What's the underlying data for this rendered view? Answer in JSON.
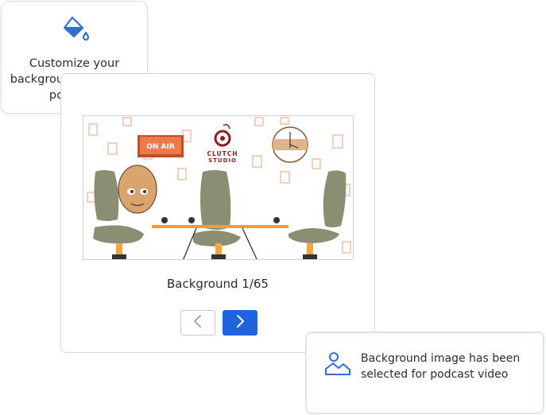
{
  "tooltip": {
    "icon": "paint-bucket-icon",
    "text": "Customize your background to fit your podcast!"
  },
  "preview": {
    "sign_text": "ON AIR",
    "logo_line1": "CLUTCH",
    "logo_line2": "STUDIO"
  },
  "background": {
    "label": "Background 1/65"
  },
  "navigation": {
    "prev_icon": "chevron-left-icon",
    "next_icon": "chevron-right-icon"
  },
  "notification": {
    "icon": "image-icon",
    "text": "Background image has been selected for podcast video"
  },
  "colors": {
    "accent": "#1f63e0",
    "icon_blue": "#2f6fd8",
    "sign_orange": "#e0652f",
    "table_orange": "#f29a3a",
    "chair_green": "#8a8f74",
    "logo_red": "#8c1d1d"
  }
}
